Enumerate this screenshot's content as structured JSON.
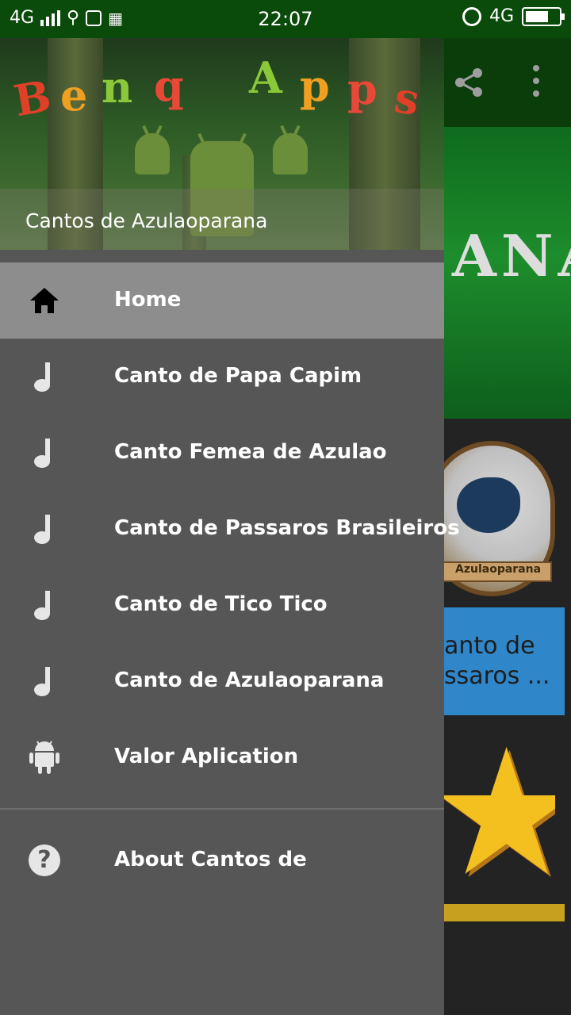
{
  "status_bar": {
    "left_network": "4G",
    "time": "22:07",
    "right_network": "4G"
  },
  "background_app": {
    "banner_text": "ANA",
    "logo_plate_text": "Azulaoparana",
    "blue_card_lines": [
      "anto de",
      "ssaros ..."
    ]
  },
  "drawer": {
    "brand_letters": [
      "B",
      "e",
      "n",
      "q",
      " ",
      "A",
      "p",
      "p",
      "s"
    ],
    "header_title": "Cantos de Azulaoparana",
    "items": [
      {
        "label": "Home",
        "icon": "home-icon",
        "active": true
      },
      {
        "label": "Canto de Papa Capim",
        "icon": "music-note-icon",
        "active": false
      },
      {
        "label": "Canto Femea de Azulao",
        "icon": "music-note-icon",
        "active": false
      },
      {
        "label": "Canto de Passaros Brasileiros",
        "icon": "music-note-icon",
        "active": false
      },
      {
        "label": "Canto de Tico Tico",
        "icon": "music-note-icon",
        "active": false
      },
      {
        "label": "Canto de Azulaoparana",
        "icon": "music-note-icon",
        "active": false
      },
      {
        "label": "Valor Aplication",
        "icon": "android-icon",
        "active": false
      }
    ],
    "about": {
      "label": "About Cantos de",
      "icon": "help-icon"
    }
  },
  "colors": {
    "status_bar": "#0a4a0a",
    "drawer_bg": "#565656",
    "active_item_bg": "#8d8d8d",
    "toolbar": "#0b3d0b"
  }
}
